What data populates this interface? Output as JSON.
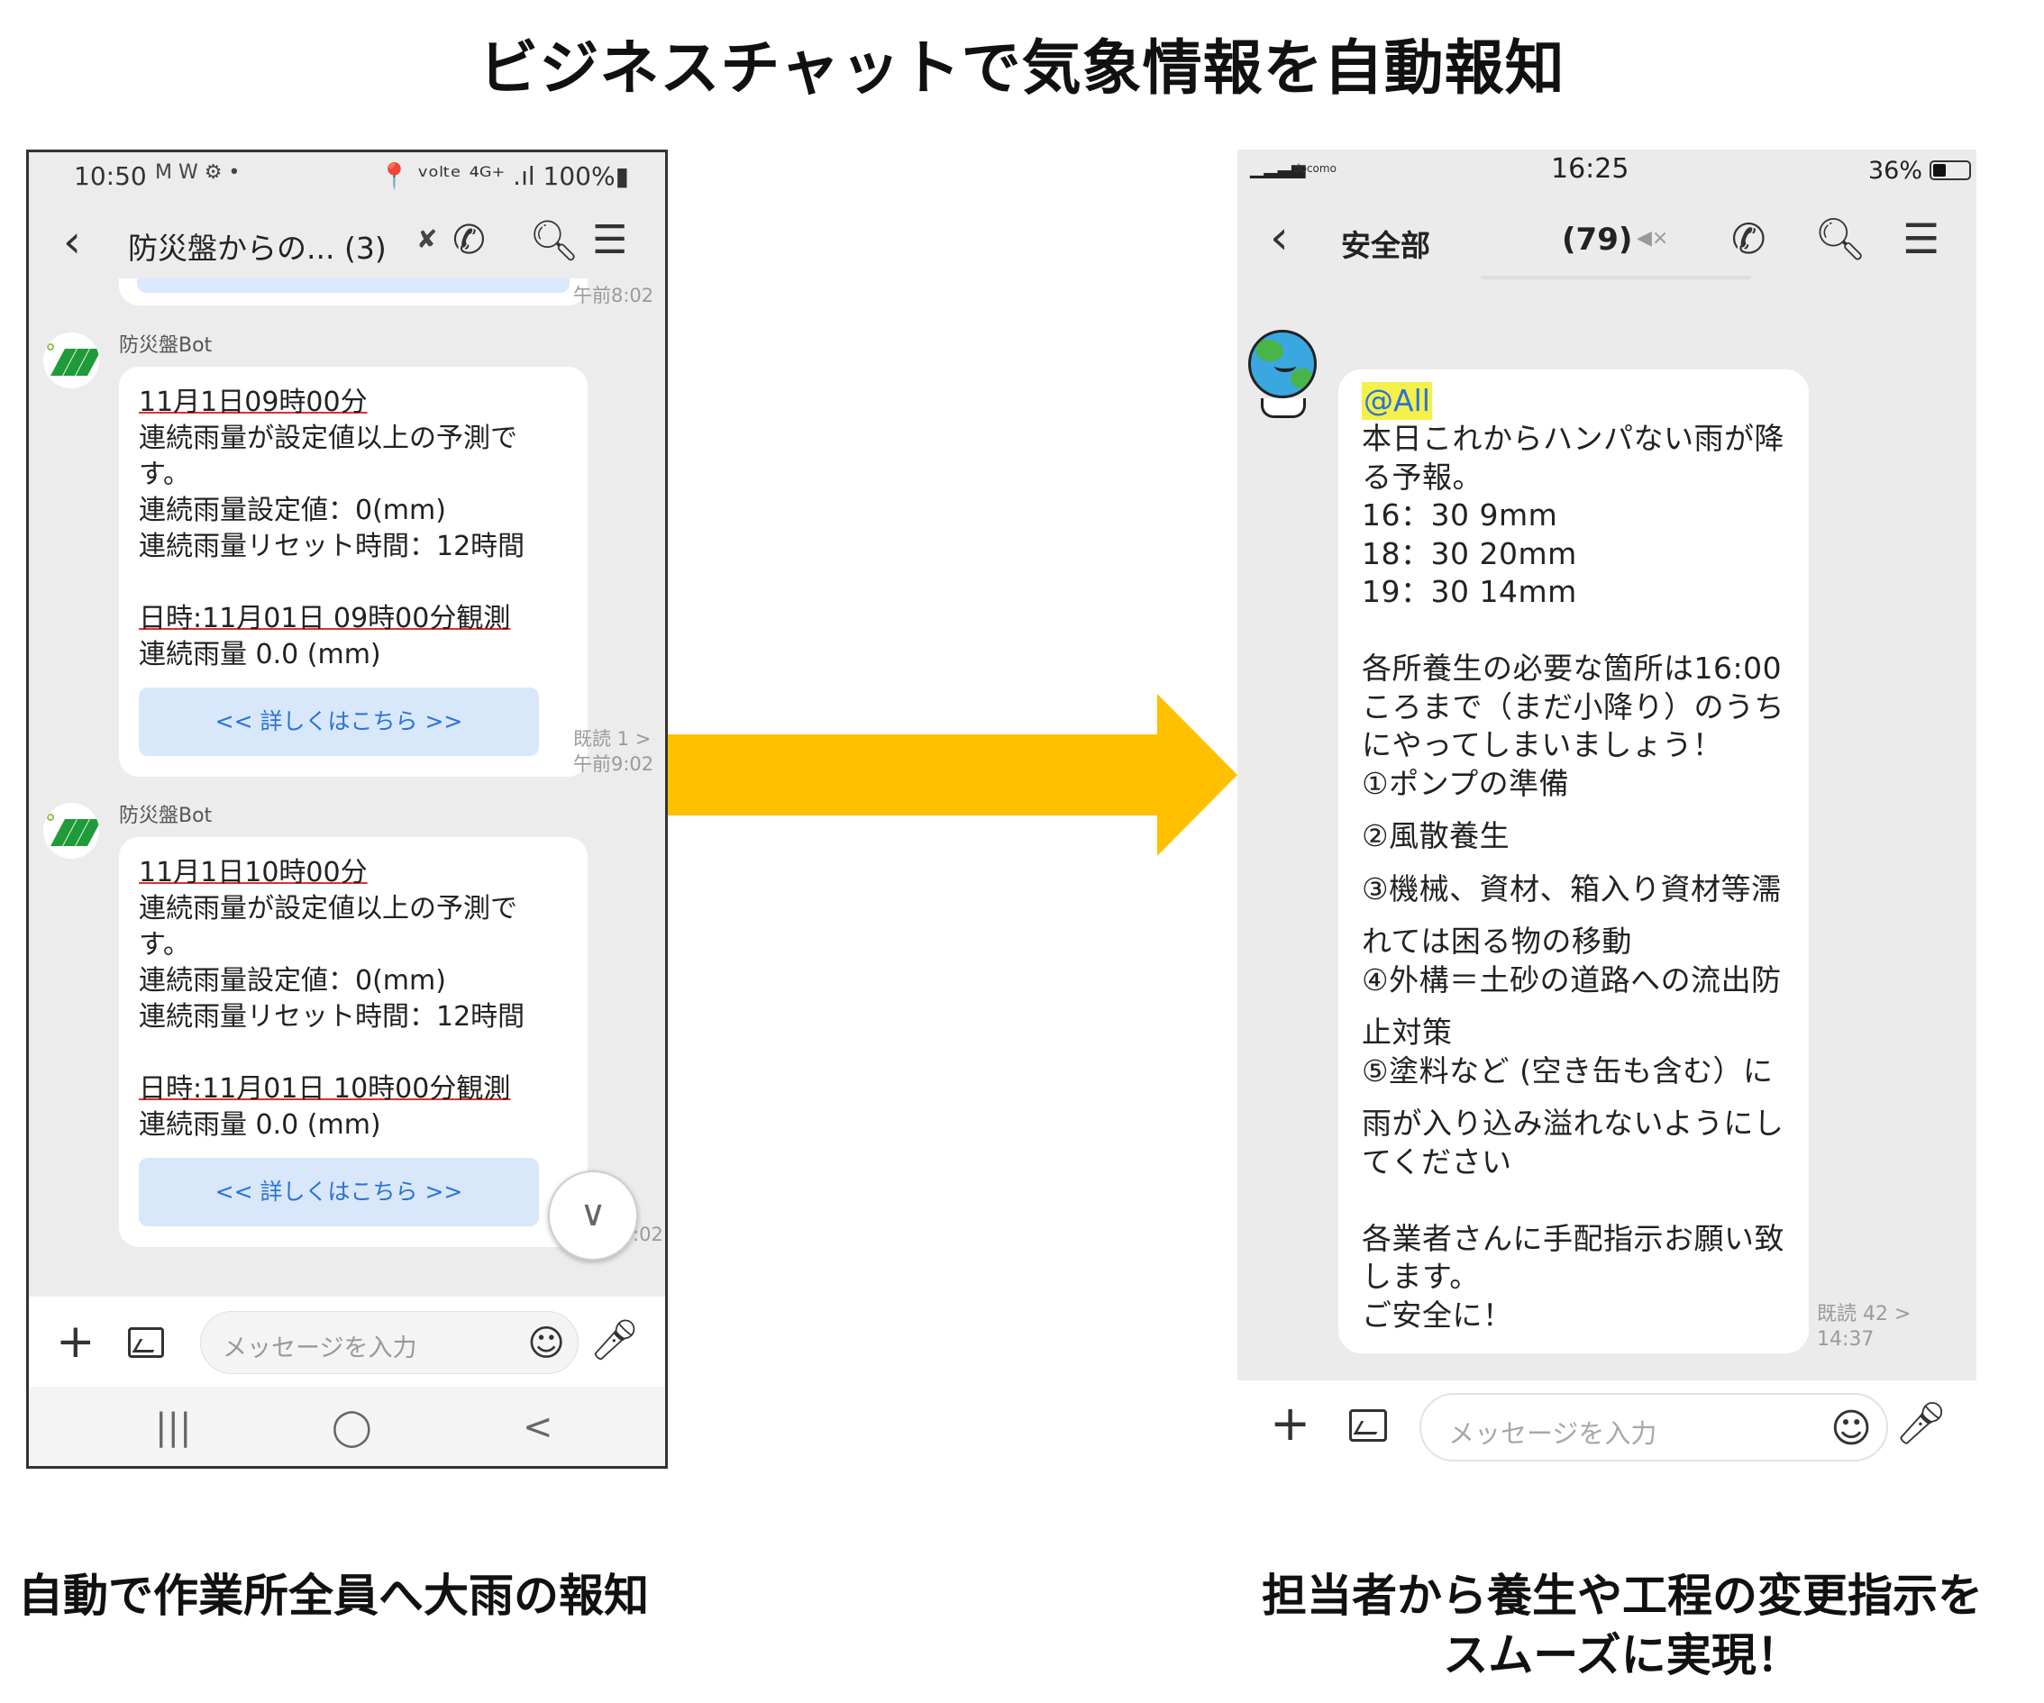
{
  "title": "ビジネスチャットで気象情報を自動報知",
  "left_phone": {
    "status": {
      "time": "10:50",
      "icons": "M W ⚙ •",
      "right": "📍 ᵛᵒˡᵗᵉ ⁴ᴳ⁺ .ıl 100%▮"
    },
    "header": {
      "title": "防災盤からの... (3)",
      "mute_icon": "speaker-muted-icon"
    },
    "top_timestamp": "午前8:02",
    "messages": [
      {
        "sender": "防災盤Bot",
        "lines": [
          "11月1日09時00分",
          "連続雨量が設定値以上の予測で",
          "す。",
          "連続雨量設定値：0(mm)",
          "連続雨量リセット時間：12時間",
          "",
          "日時:11月01日 09時00分観測",
          "連続雨量 0.0 (mm)"
        ],
        "link": "<< 詳しくはこちら >>",
        "read": "既読 1 >",
        "time": "午前9:02"
      },
      {
        "sender": "防災盤Bot",
        "lines": [
          "11月1日10時00分",
          "連続雨量が設定値以上の予測で",
          "す。",
          "連続雨量設定値：0(mm)",
          "連続雨量リセット時間：12時間",
          "",
          "日時:11月01日 10時00分観測",
          "連続雨量 0.0 (mm)"
        ],
        "link": "<< 詳しくはこちら >>",
        "time": ":02"
      }
    ],
    "input_placeholder": "メッセージを入力",
    "nav": [
      "|||",
      "◯",
      "<"
    ]
  },
  "right_phone": {
    "status": {
      "carrier": "docomo",
      "time": "16:25",
      "battery": "36%"
    },
    "header": {
      "title": "安全部",
      "count": "(79)",
      "mute_icon": "speaker-muted-icon"
    },
    "message": {
      "mention": "@All",
      "lines": [
        "本日これからハンパない雨が降",
        "る予報。",
        "16：30 9mm",
        "18：30 20mm",
        "19：30 14mm",
        "",
        "各所養生の必要な箇所は16:00",
        "ころまで（まだ小降り）のうち",
        "にやってしまいましょう！",
        "①ポンプの準備",
        "②風散養生",
        "③機械、資材、箱入り資材等濡",
        "れては困る物の移動",
        "④外構＝土砂の道路への流出防",
        "止対策",
        "⑤塗料など (空き缶も含む）に",
        "雨が入り込み溢れないようにし",
        "てください",
        "",
        "各業者さんに手配指示お願い致",
        "します。",
        "ご安全に！"
      ],
      "read": "既読 42 >",
      "time": "14:37"
    },
    "input_placeholder": "メッセージを入力"
  },
  "captions": {
    "left": "自動で作業所全員へ大雨の報知",
    "right_line1": "担当者から養生や工程の変更指示を",
    "right_line2": "スムーズに実現！"
  },
  "colors": {
    "arrow": "#FFC000",
    "link_bg": "#D8E7FA",
    "link_text": "#2A73D6",
    "mention_bg": "#F5F04A"
  }
}
